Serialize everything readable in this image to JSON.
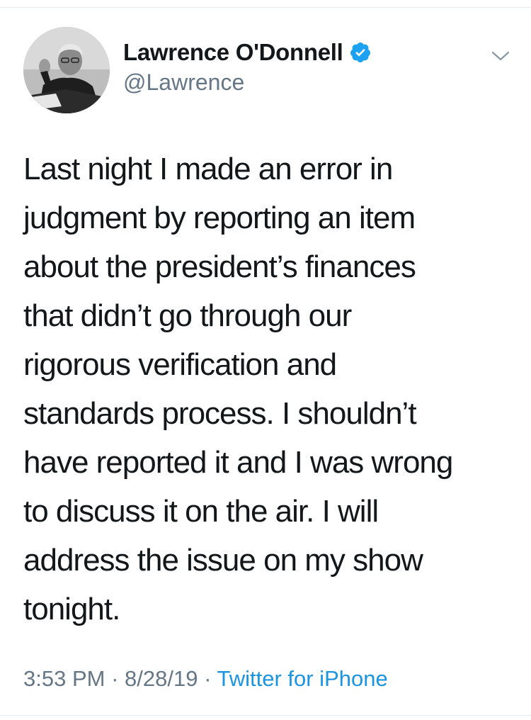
{
  "tweet": {
    "author": {
      "display_name": "Lawrence O'Donnell",
      "handle": "@Lawrence",
      "verified": true,
      "avatar_icon": "profile-photo"
    },
    "text_lines": [
      "Last night I made an error in",
      "judgment by reporting an item",
      "about the president’s finances",
      "that didn’t go through our",
      "rigorous verification and",
      "standards process. I shouldn’t",
      "have reported it and I was wrong",
      "to discuss it on the air. I will",
      "address the issue on my show",
      "tonight."
    ],
    "time": "3:53 PM",
    "separator": "·",
    "date": "8/28/19",
    "source": "Twitter for iPhone",
    "menu_icon": "chevron-down-icon"
  },
  "colors": {
    "text": "#14171a",
    "secondary": "#657786",
    "link": "#1b95e0",
    "verified": "#1da1f2",
    "divider": "#e6ecf0"
  }
}
